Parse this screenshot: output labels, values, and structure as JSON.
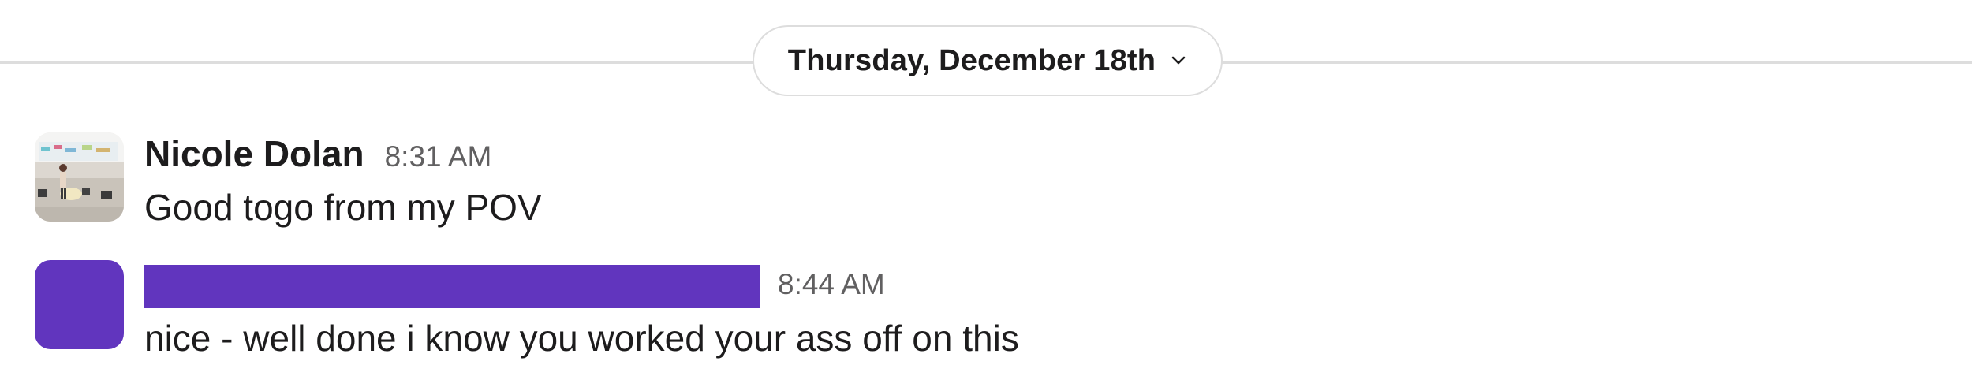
{
  "date_divider": {
    "label": "Thursday, December 18th",
    "icon": "chevron-down-icon"
  },
  "messages": [
    {
      "sender": "Nicole Dolan",
      "time": "8:31 AM",
      "text": "Good togo from my POV",
      "avatar": "photo"
    },
    {
      "sender": "",
      "sender_redacted": true,
      "time": "8:44 AM",
      "text": "nice - well done i know you worked your ass off on this",
      "avatar": "solid",
      "avatar_color": "#6135be"
    }
  ],
  "colors": {
    "redaction": "#6135be",
    "divider": "#dddddd",
    "timestamp": "#616061",
    "text": "#1d1c1d"
  }
}
